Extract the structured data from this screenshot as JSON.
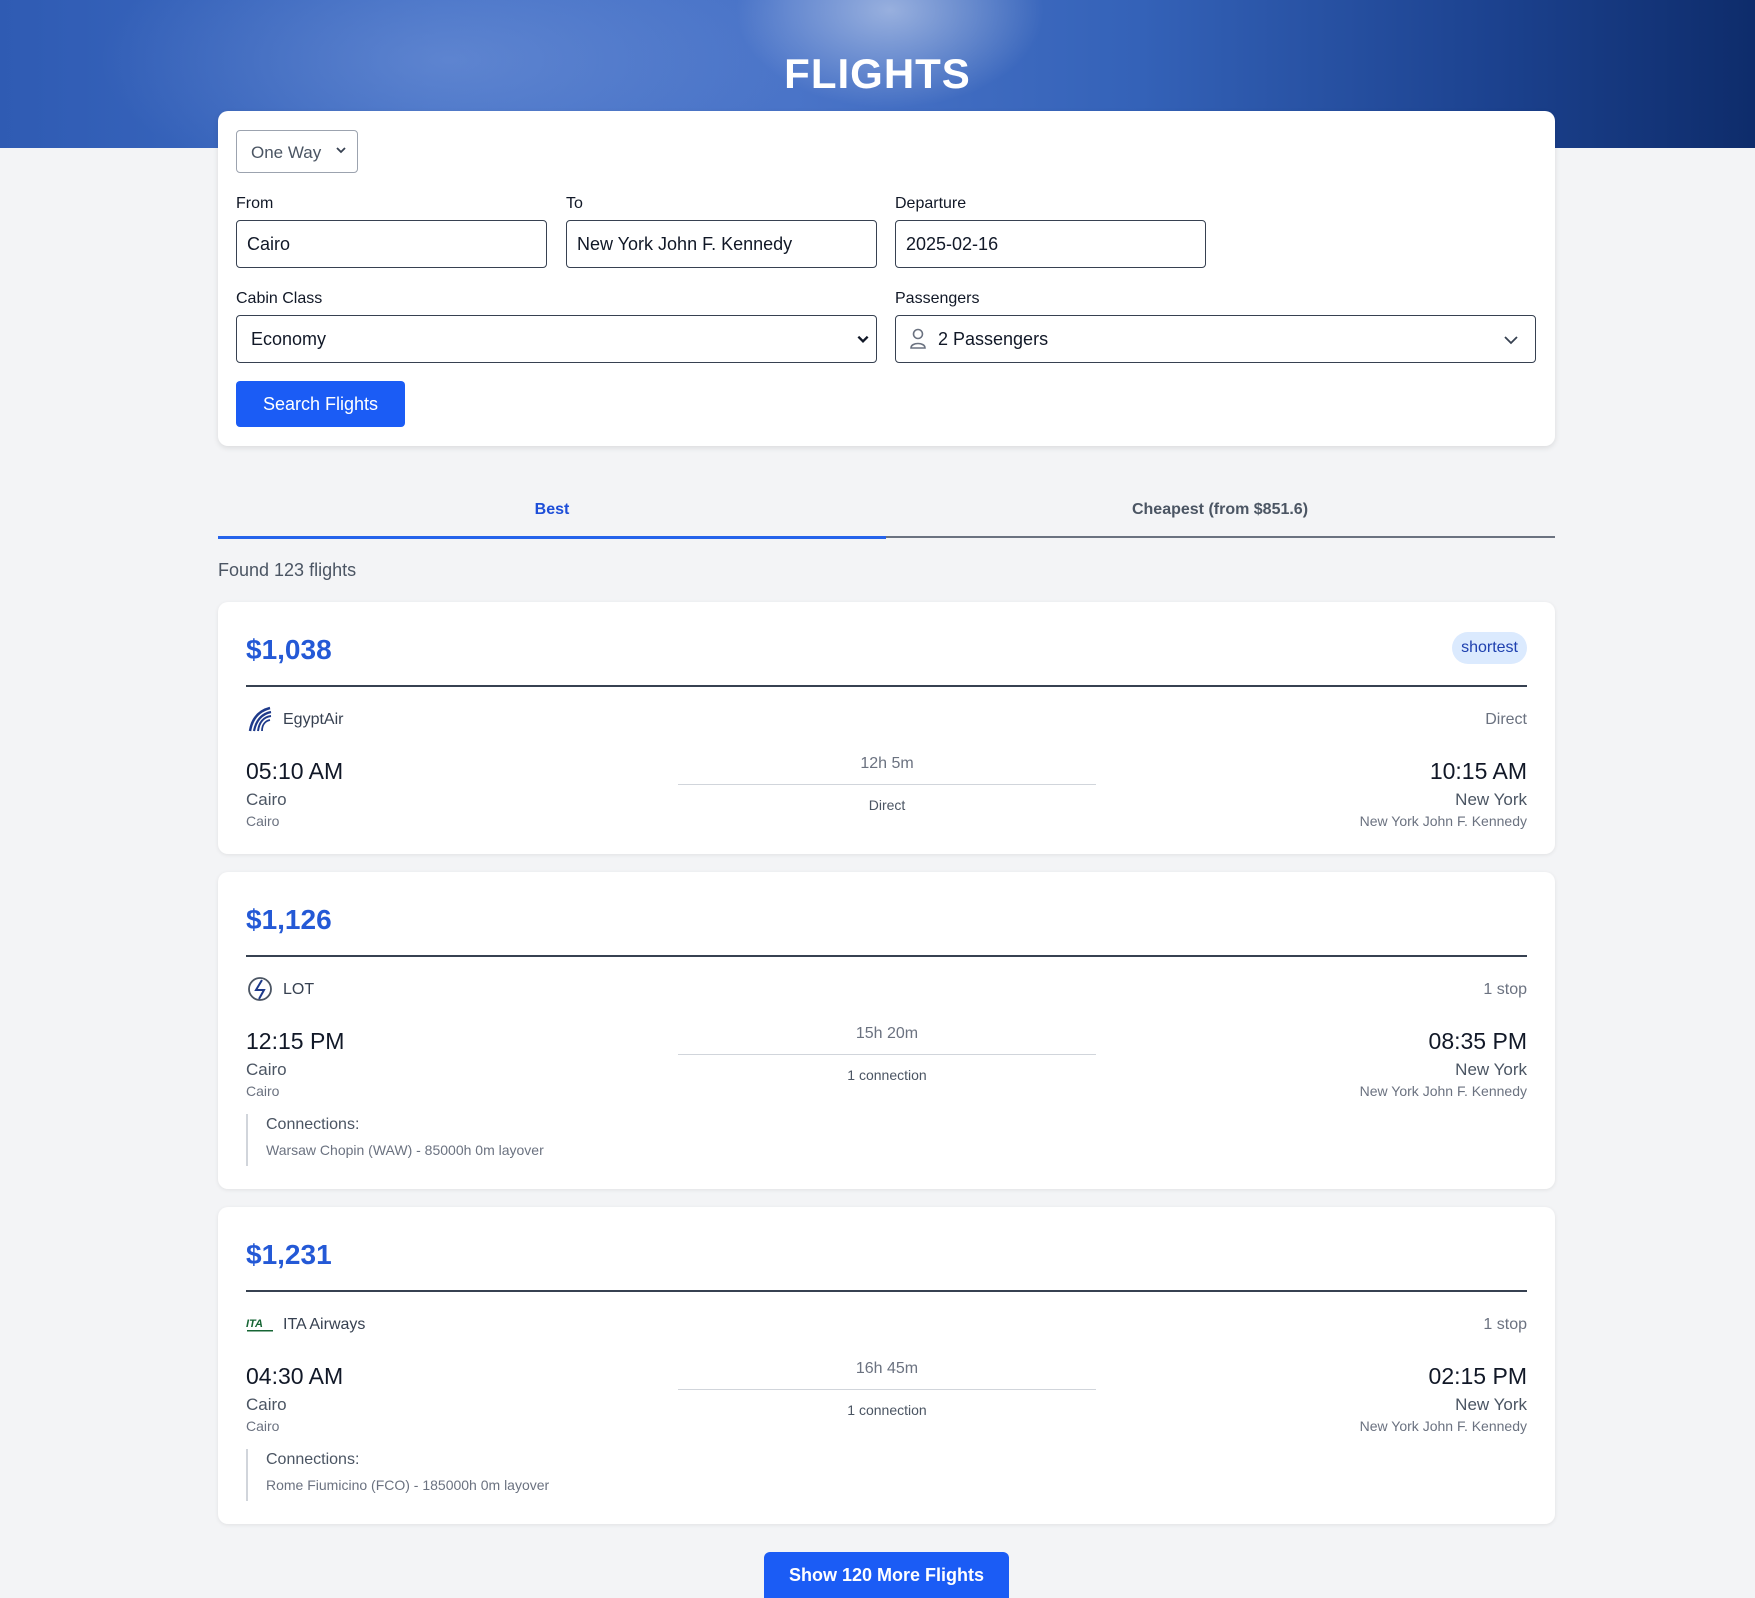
{
  "header": {
    "title": "FLIGHTS"
  },
  "search": {
    "trip_type": "One Way",
    "from_label": "From",
    "from_value": "Cairo",
    "to_label": "To",
    "to_value": "New York John F. Kennedy",
    "departure_label": "Departure",
    "departure_value": "2025-02-16",
    "cabin_label": "Cabin Class",
    "cabin_value": "Economy",
    "passengers_label": "Passengers",
    "passengers_value": "2 Passengers",
    "search_button": "Search Flights"
  },
  "tabs": [
    {
      "label": "Best",
      "active": true
    },
    {
      "label": "Cheapest (from $851.6)",
      "active": false
    }
  ],
  "results": {
    "found_text": "Found 123 flights",
    "flights": [
      {
        "price": "$1,038",
        "badge": "shortest",
        "airline": "EgyptAir",
        "stops": "Direct",
        "dep_time": "05:10 AM",
        "dep_city": "Cairo",
        "dep_airport": "Cairo",
        "duration": "12h 5m",
        "connection_summary": "Direct",
        "arr_time": "10:15 AM",
        "arr_city": "New York",
        "arr_airport": "New York John F. Kennedy"
      },
      {
        "price": "$1,126",
        "airline": "LOT",
        "stops": "1 stop",
        "dep_time": "12:15 PM",
        "dep_city": "Cairo",
        "dep_airport": "Cairo",
        "duration": "15h 20m",
        "connection_summary": "1 connection",
        "arr_time": "08:35 PM",
        "arr_city": "New York",
        "arr_airport": "New York John F. Kennedy",
        "connections_title": "Connections:",
        "connections_detail": "Warsaw Chopin (WAW) - 85000h 0m layover"
      },
      {
        "price": "$1,231",
        "airline": "ITA Airways",
        "stops": "1 stop",
        "dep_time": "04:30 AM",
        "dep_city": "Cairo",
        "dep_airport": "Cairo",
        "duration": "16h 45m",
        "connection_summary": "1 connection",
        "arr_time": "02:15 PM",
        "arr_city": "New York",
        "arr_airport": "New York John F. Kennedy",
        "connections_title": "Connections:",
        "connections_detail": "Rome Fiumicino (FCO) - 185000h 0m layover"
      }
    ],
    "more_button": "Show 120 More Flights"
  },
  "colors": {
    "accent": "#1b5cf5",
    "price": "#2459d6",
    "badge_bg": "#dbeafe"
  },
  "icons": {
    "trip_select": "chevron-down-icon",
    "passengers": "person-icon",
    "airlines": [
      "egyptair-logo-icon",
      "lot-logo-icon",
      "ita-airways-logo-icon"
    ]
  }
}
